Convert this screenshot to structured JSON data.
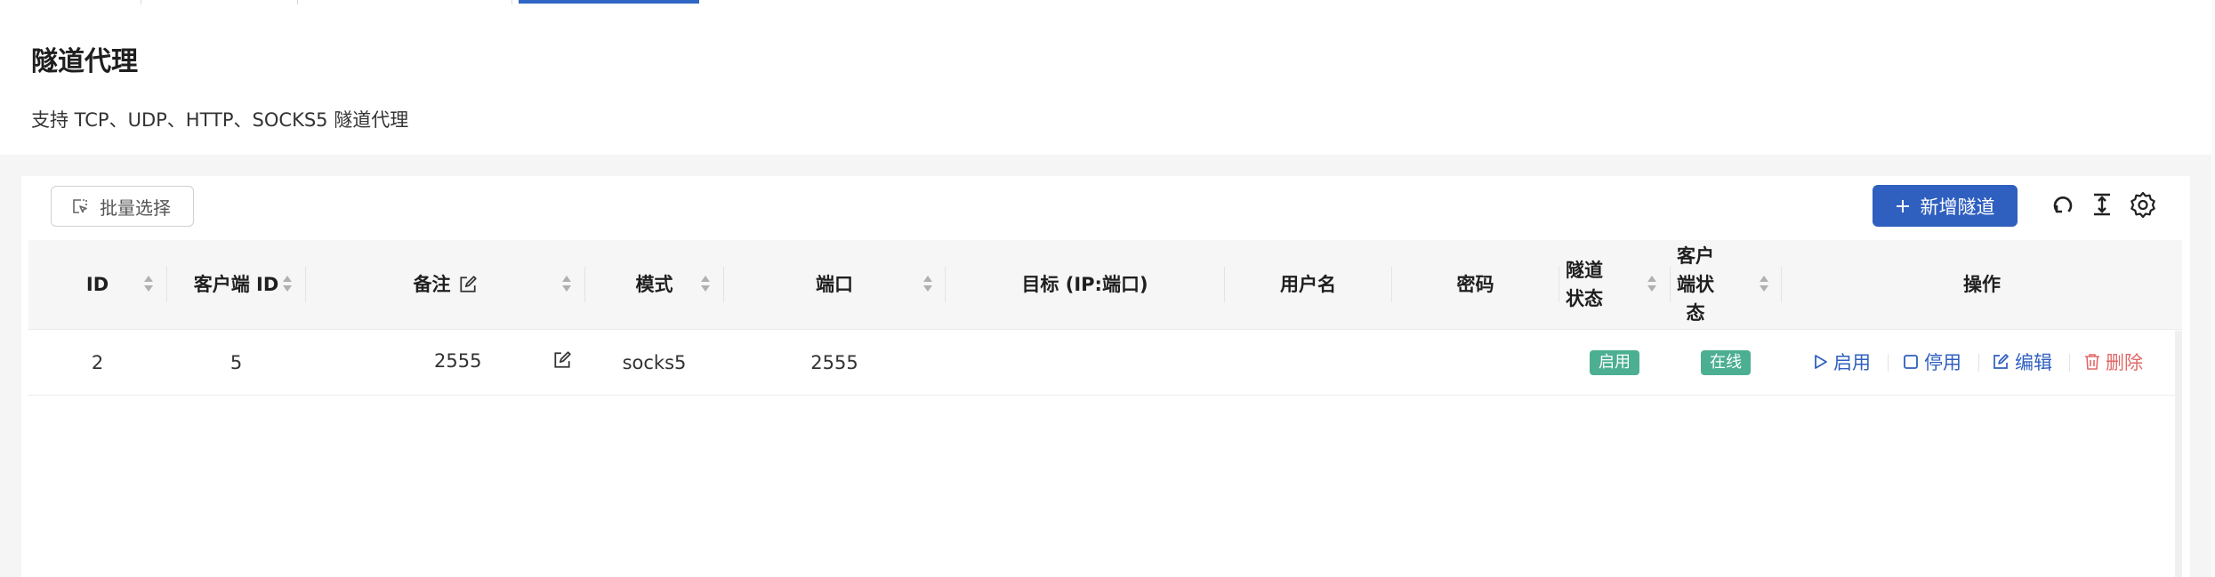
{
  "header": {
    "title": "隧道代理",
    "description": "支持 TCP、UDP、HTTP、SOCKS5 隧道代理"
  },
  "toolbar": {
    "batch_select_label": "批量选择",
    "new_tunnel_label": "新增隧道",
    "new_tunnel_icon": "plus-icon",
    "tool_icons": [
      "reload-icon",
      "column-height-icon",
      "setting-icon"
    ]
  },
  "table": {
    "columns": {
      "id": "ID",
      "client_id": "客户端 ID",
      "remark": "备注",
      "mode": "模式",
      "port": "端口",
      "target": "目标 (IP:端口)",
      "username": "用户名",
      "password": "密码",
      "tunnel_status": "隧道状态",
      "client_status": "客户端状态",
      "actions": "操作"
    },
    "rows": [
      {
        "id": "2",
        "client_id": "5",
        "remark": "2555",
        "mode": "socks5",
        "port": "2555",
        "target": "",
        "username": "",
        "password": "",
        "tunnel_status": "启用",
        "client_status": "在线",
        "actions": {
          "start": "启用",
          "stop": "停用",
          "edit": "编辑",
          "delete": "删除"
        }
      }
    ]
  },
  "colors": {
    "primary": "#2f5fbf",
    "active_tab": "#2f66c4",
    "status_tag": "#4caf91",
    "danger": "#e06868"
  }
}
